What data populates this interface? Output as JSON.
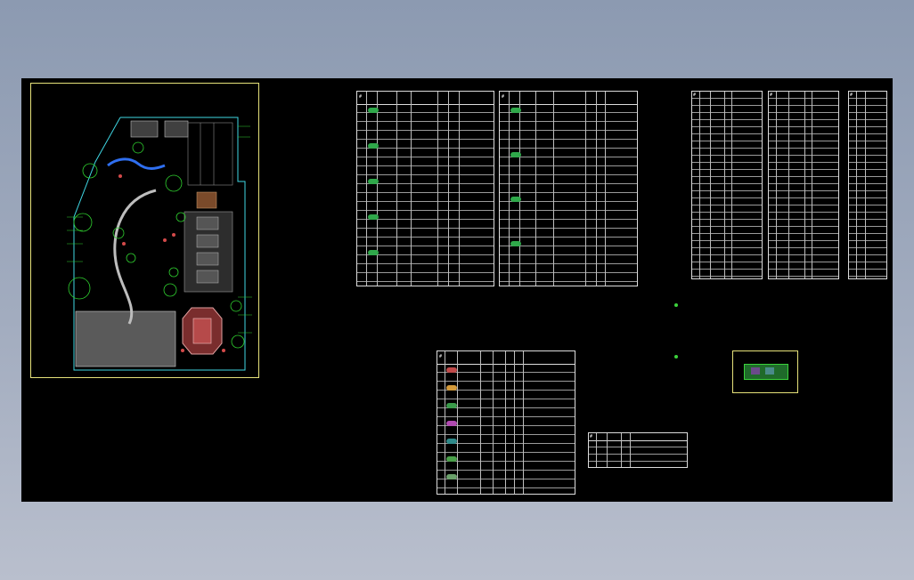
{
  "canvas": {
    "background": "#000000"
  },
  "colors": {
    "frame": "#e6e27a",
    "site_outline": "#3fd7e4",
    "plants": "#2fd12f",
    "table_lines": "#dcdcdc"
  },
  "icons": [
    "site-plan-drawing",
    "plant-symbol",
    "thumbnail-detail"
  ],
  "tables": {
    "t1": {
      "title": "",
      "headers": [
        "#",
        "",
        "",
        "",
        "",
        ""
      ]
    },
    "t2": {
      "title": "",
      "headers": [
        "#",
        "",
        "",
        "",
        "",
        ""
      ]
    },
    "t3": {
      "title": "",
      "headers": [
        "#",
        "",
        "",
        ""
      ]
    },
    "t4": {
      "title": "",
      "headers": [
        "#",
        "",
        "",
        ""
      ]
    },
    "t5": {
      "title": "",
      "headers": [
        "#",
        "",
        ""
      ]
    },
    "t6": {
      "title": "",
      "headers": [
        "#",
        "",
        "",
        ""
      ]
    },
    "t7": {
      "title": "",
      "headers": [
        "#",
        "",
        ""
      ]
    }
  }
}
